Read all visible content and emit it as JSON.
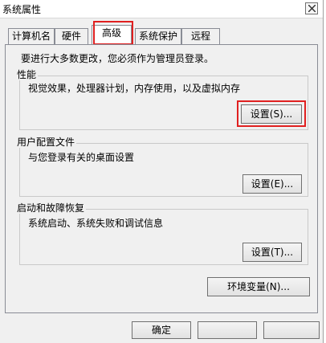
{
  "window": {
    "title": "系统属性"
  },
  "tabs": [
    {
      "label": "计算机名"
    },
    {
      "label": "硬件"
    },
    {
      "label": "高级"
    },
    {
      "label": "系统保护"
    },
    {
      "label": "远程"
    }
  ],
  "active_tab": "高级",
  "admin_note": "要进行大多数更改，您必须作为管理员登录。",
  "performance": {
    "title": "性能",
    "description": "视觉效果，处理器计划，内存使用，以及虚拟内存",
    "button": "设置(S)..."
  },
  "user_profiles": {
    "title": "用户配置文件",
    "description": "与您登录有关的桌面设置",
    "button": "设置(E)..."
  },
  "startup_recovery": {
    "title": "启动和故障恢复",
    "description": "系统启动、系统失败和调试信息",
    "button": "设置(T)..."
  },
  "env_button": "环境变量(N)...",
  "footer": {
    "ok": "确定"
  },
  "highlight_color": "#e02020"
}
